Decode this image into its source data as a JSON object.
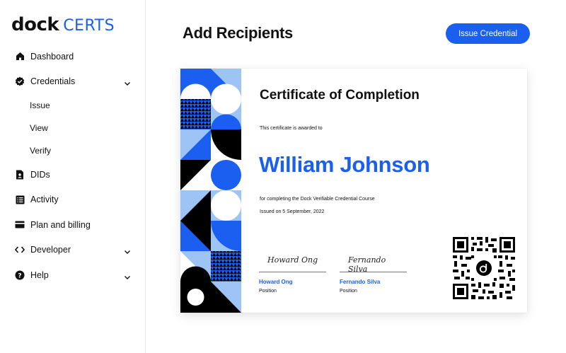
{
  "brand": {
    "word": "dock",
    "product": "CERTS"
  },
  "sidebar": {
    "items": [
      {
        "label": "Dashboard"
      },
      {
        "label": "Credentials",
        "children": [
          "Issue",
          "View",
          "Verify"
        ]
      },
      {
        "label": "DIDs"
      },
      {
        "label": "Activity"
      },
      {
        "label": "Plan and billing"
      },
      {
        "label": "Developer"
      },
      {
        "label": "Help"
      }
    ]
  },
  "header": {
    "title": "Add Recipients",
    "issue_button": "Issue Credential"
  },
  "certificate": {
    "title": "Certificate of Completion",
    "awarded_text": "This certificate is awarded to",
    "recipient_name": "William Johnson",
    "course_text": "for completing the Dock Verifiable Credential Course",
    "issued_text": "Issued on 5 September, 2022",
    "signatories": [
      {
        "signature": "Howard Ong",
        "name": "Howard Ong",
        "position": "Position"
      },
      {
        "signature": "Fernando Silva",
        "name": "Fernando Silva",
        "position": "Position"
      }
    ]
  },
  "colors": {
    "accent": "#1a5ff0",
    "light_blue": "#9dc4f5",
    "dark": "#000000"
  }
}
